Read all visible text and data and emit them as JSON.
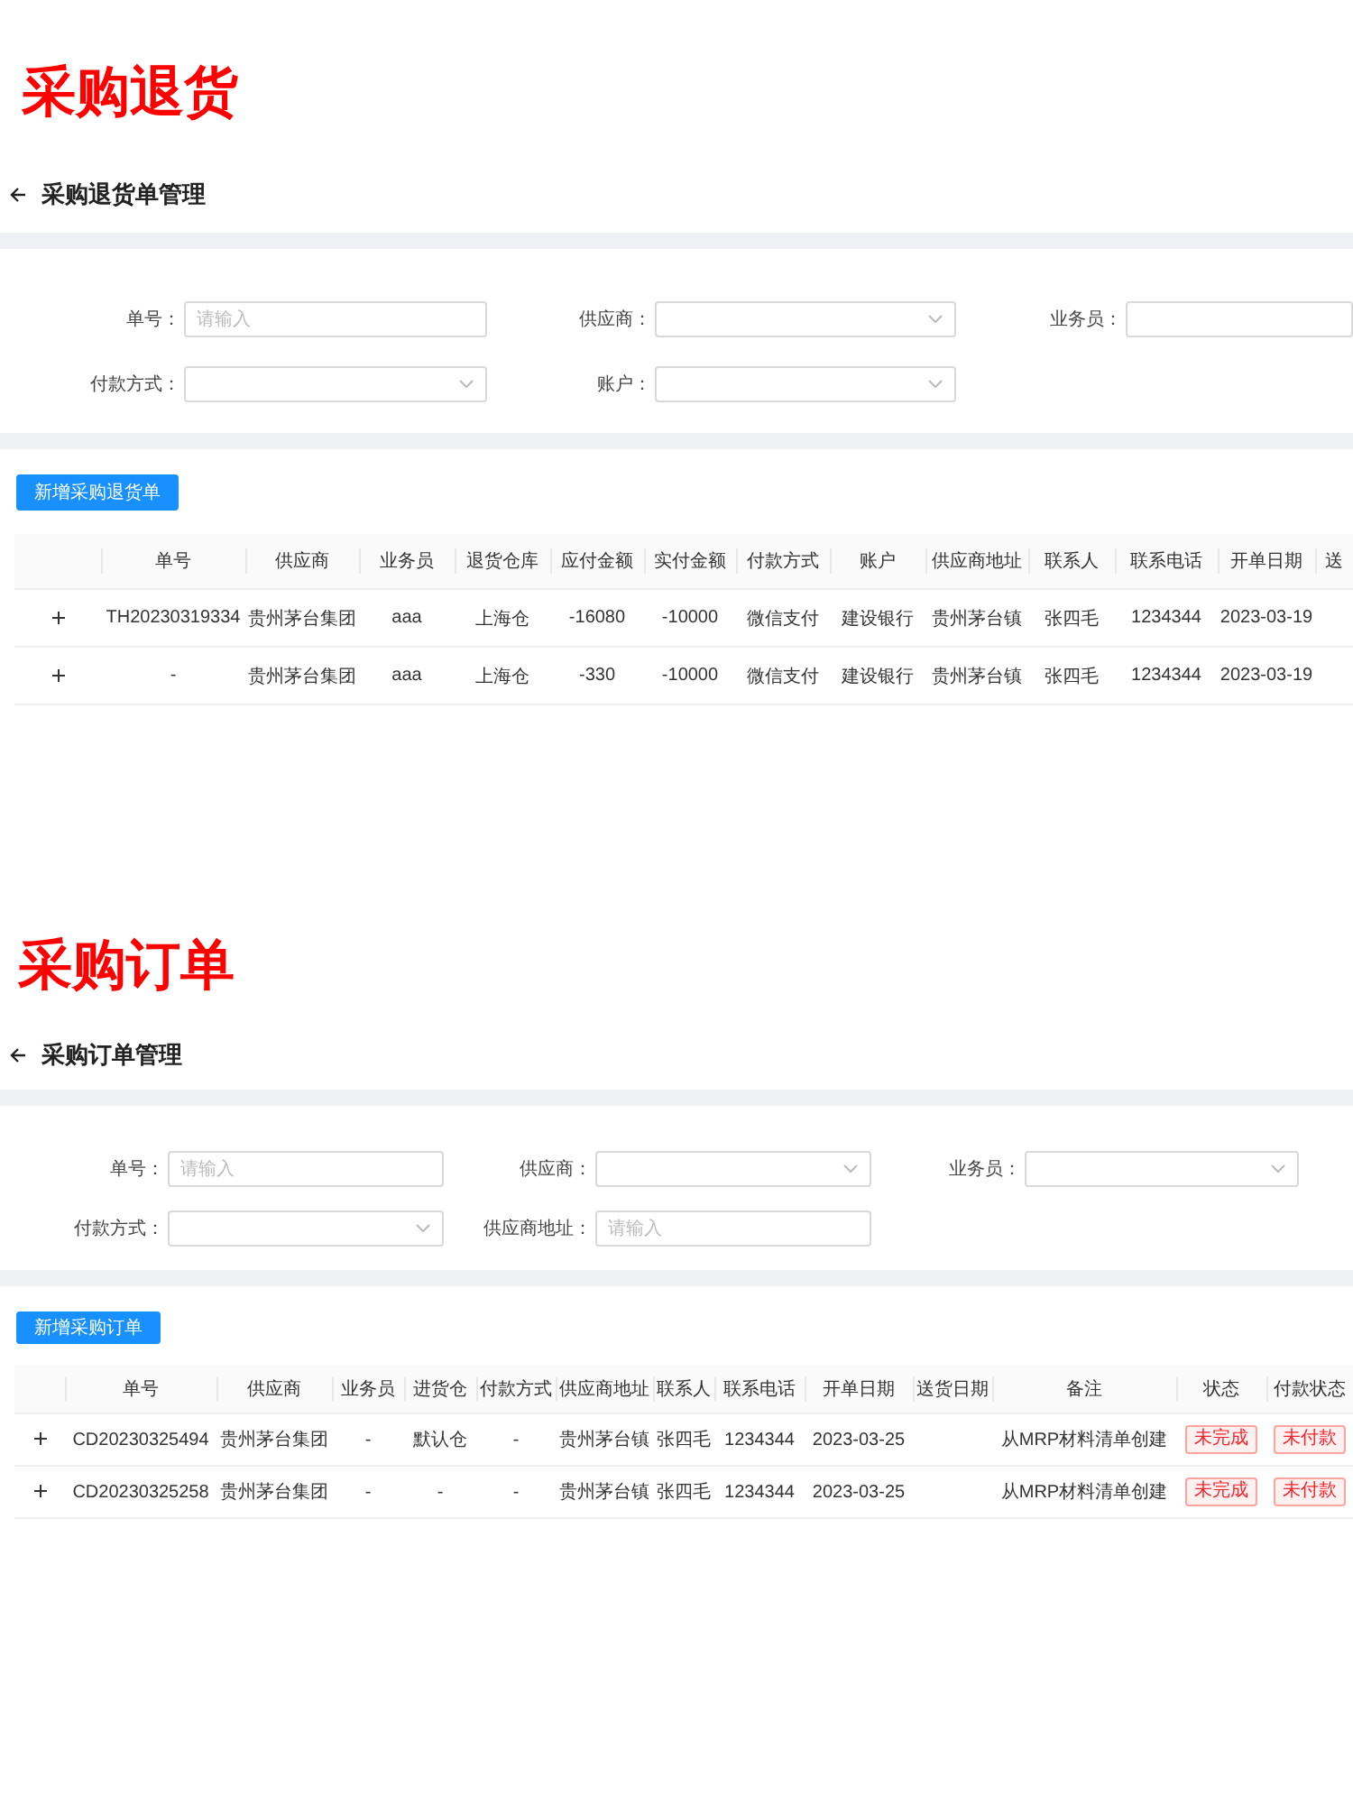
{
  "sections": [
    {
      "heading": "采购退货",
      "page_title": "采购退货单管理",
      "filters": [
        {
          "label": "单号：",
          "kind": "input",
          "placeholder": "请输入"
        },
        {
          "label": "供应商：",
          "kind": "select"
        },
        {
          "label": "业务员：",
          "kind": "input"
        },
        {
          "label": "付款方式：",
          "kind": "select"
        },
        {
          "label": "账户：",
          "kind": "select"
        }
      ],
      "add_button": "新增采购退货单",
      "table": {
        "columns": [
          {
            "label": "单号",
            "kind": "text"
          },
          {
            "label": "供应商",
            "kind": "text"
          },
          {
            "label": "业务员",
            "kind": "text"
          },
          {
            "label": "退货仓库",
            "kind": "text"
          },
          {
            "label": "应付金额",
            "kind": "text"
          },
          {
            "label": "实付金额",
            "kind": "text"
          },
          {
            "label": "付款方式",
            "kind": "text"
          },
          {
            "label": "账户",
            "kind": "text"
          },
          {
            "label": "供应商地址",
            "kind": "text"
          },
          {
            "label": "联系人",
            "kind": "text"
          },
          {
            "label": "联系电话",
            "kind": "text"
          },
          {
            "label": "开单日期",
            "kind": "text"
          },
          {
            "label": "送",
            "kind": "text"
          }
        ],
        "rows": [
          {
            "expanded": false,
            "cells": [
              "TH20230319334",
              "贵州茅台集团",
              "aaa",
              "上海仓",
              "-16080",
              "-10000",
              "微信支付",
              "建设银行",
              "贵州茅台镇",
              "张四毛",
              "1234344",
              "2023-03-19"
            ]
          },
          {
            "expanded": false,
            "cells": [
              "-",
              "贵州茅台集团",
              "aaa",
              "上海仓",
              "-330",
              "-10000",
              "微信支付",
              "建设银行",
              "贵州茅台镇",
              "张四毛",
              "1234344",
              "2023-03-19"
            ]
          }
        ]
      }
    },
    {
      "heading": "采购订单",
      "page_title": "采购订单管理",
      "filters": [
        {
          "label": "单号：",
          "kind": "input",
          "placeholder": "请输入"
        },
        {
          "label": "供应商：",
          "kind": "select"
        },
        {
          "label": "业务员：",
          "kind": "select"
        },
        {
          "label": "付款方式：",
          "kind": "select"
        },
        {
          "label": "供应商地址：",
          "kind": "input",
          "placeholder": "请输入"
        }
      ],
      "add_button": "新增采购订单",
      "table": {
        "columns": [
          {
            "label": "单号",
            "kind": "text"
          },
          {
            "label": "供应商",
            "kind": "text"
          },
          {
            "label": "业务员",
            "kind": "text"
          },
          {
            "label": "进货仓",
            "kind": "text"
          },
          {
            "label": "付款方式",
            "kind": "text"
          },
          {
            "label": "供应商地址",
            "kind": "text"
          },
          {
            "label": "联系人",
            "kind": "text"
          },
          {
            "label": "联系电话",
            "kind": "text"
          },
          {
            "label": "开单日期",
            "kind": "text"
          },
          {
            "label": "送货日期",
            "kind": "text"
          },
          {
            "label": "备注",
            "kind": "text"
          },
          {
            "label": "状态",
            "kind": "tag"
          },
          {
            "label": "付款状态",
            "kind": "tag"
          }
        ],
        "rows": [
          {
            "expanded": false,
            "cells": [
              "CD20230325494",
              "贵州茅台集团",
              "-",
              "默认仓",
              "-",
              "贵州茅台镇",
              "张四毛",
              "1234344",
              "2023-03-25",
              null,
              "从MRP材料清单创建",
              "未完成",
              "未付款"
            ]
          },
          {
            "expanded": false,
            "cells": [
              "CD20230325258",
              "贵州茅台集团",
              "-",
              "-",
              "-",
              "贵州茅台镇",
              "张四毛",
              "1234344",
              "2023-03-25",
              null,
              "从MRP材料清单创建",
              "未完成",
              "未付款"
            ]
          }
        ]
      }
    }
  ]
}
